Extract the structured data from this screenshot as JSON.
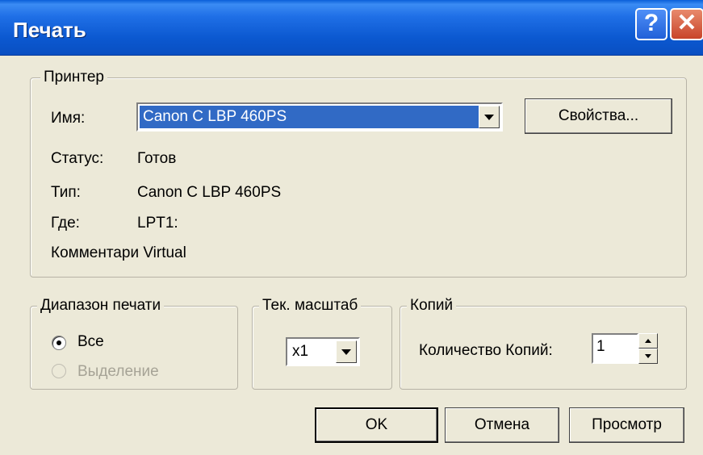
{
  "window": {
    "title": "Печать",
    "help_glyph": "?",
    "close_glyph": "✕"
  },
  "printer": {
    "legend": "Принтер",
    "name_label": "Имя:",
    "name_value": "Canon C LBP 460PS",
    "properties_label": "Свойства...",
    "status_label": "Статус:",
    "status_value": "Готов",
    "type_label": "Тип:",
    "type_value": "Canon C LBP 460PS",
    "where_label": "Где:",
    "where_value": "LPT1:",
    "comment_text": "Комментари Virtual"
  },
  "range": {
    "legend": "Диапазон печати",
    "all_label": "Все",
    "selection_label": "Выделение"
  },
  "scale": {
    "legend": "Тек. масштаб",
    "value": "x1"
  },
  "copies": {
    "legend": "Копий",
    "count_label": "Количество Копий:",
    "count_value": "1"
  },
  "buttons": {
    "ok": "OK",
    "cancel": "Отмена",
    "preview": "Просмотр"
  }
}
